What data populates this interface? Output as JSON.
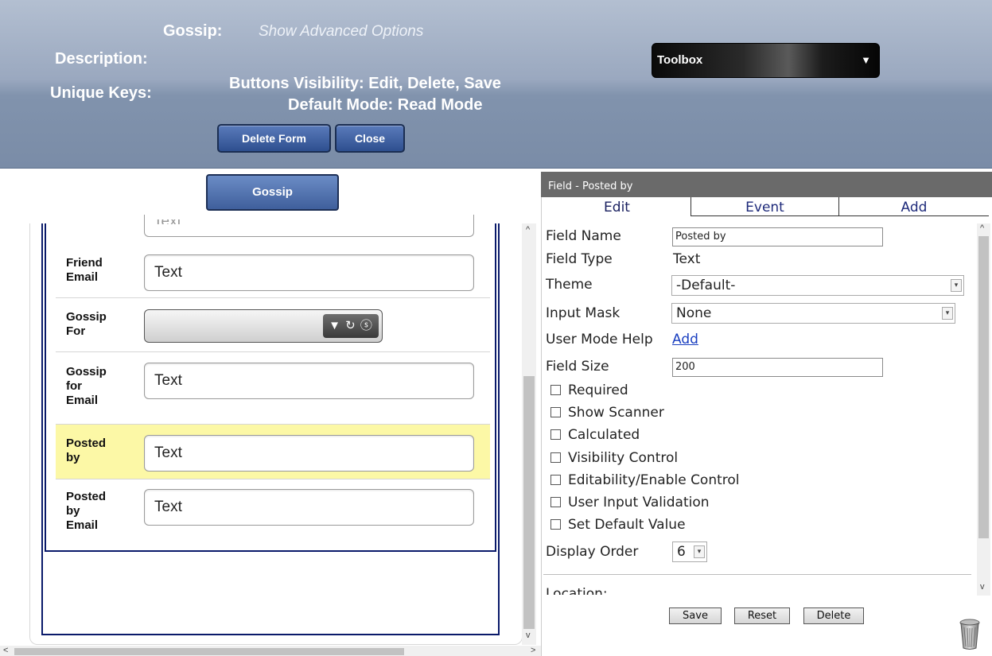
{
  "header": {
    "form_name_label": "Gossip:",
    "advanced_link": "Show Advanced Options",
    "description_label": "Description:",
    "unique_keys_label": "Unique Keys:",
    "buttons_visibility": "Buttons Visibility: Edit, Delete, Save",
    "default_mode": "Default Mode: Read Mode",
    "delete_form_button": "Delete Form",
    "close_button": "Close",
    "toolbox_label": "Toolbox",
    "toolbox_arrow": "▼"
  },
  "form": {
    "tab_label": "Gossip",
    "partial_value": "Text",
    "rows": [
      {
        "label": "Friend\nEmail",
        "value": "Text"
      },
      {
        "label": "Gossip\nFor",
        "tools": "▼ ↻ ⓢ"
      },
      {
        "label": "Gossip\nfor\nEmail",
        "value": "Text"
      },
      {
        "label": "Posted\nby",
        "value": "Text",
        "highlighted": true
      },
      {
        "label": "Posted\nby\nEmail",
        "value": "Text"
      }
    ]
  },
  "field_panel": {
    "title": "Field - Posted by",
    "tabs": [
      "Edit",
      "Event",
      "Add"
    ],
    "active_tab": "Edit",
    "field_name_label": "Field Name",
    "field_name_value": "Posted by",
    "field_type_label": "Field Type",
    "field_type_value": "Text",
    "theme_label": "Theme",
    "theme_value": "-Default-",
    "input_mask_label": "Input Mask",
    "input_mask_value": "None",
    "user_mode_help_label": "User Mode Help",
    "user_mode_help_link": "Add",
    "field_size_label": "Field Size",
    "field_size_value": "200",
    "checkboxes": [
      {
        "label": "Required",
        "checked": false
      },
      {
        "label": "Show Scanner",
        "checked": false
      },
      {
        "label": "Calculated",
        "checked": false
      },
      {
        "label": "Visibility Control",
        "checked": false
      },
      {
        "label": "Editability/Enable Control",
        "checked": false
      },
      {
        "label": "User Input Validation",
        "checked": false
      },
      {
        "label": "Set Default Value",
        "checked": false
      }
    ],
    "display_order_label": "Display Order",
    "display_order_value": "6",
    "location_label": "Location:",
    "save_button": "Save",
    "reset_button": "Reset",
    "delete_button": "Delete"
  },
  "icons": {
    "dropdown_arrow": "▾",
    "scroll_up": "^",
    "scroll_down": "v",
    "scroll_left": "<",
    "scroll_right": ">"
  },
  "colors": {
    "header_top": "#b3bfd1",
    "header_bottom": "#7a8ca7",
    "button_blue": "#3f5f9c",
    "form_border": "#0a1a6a",
    "highlight_row": "#fcf8a6",
    "link_blue": "#1a3fc0",
    "panel_title_bg": "#6a6a6a"
  }
}
